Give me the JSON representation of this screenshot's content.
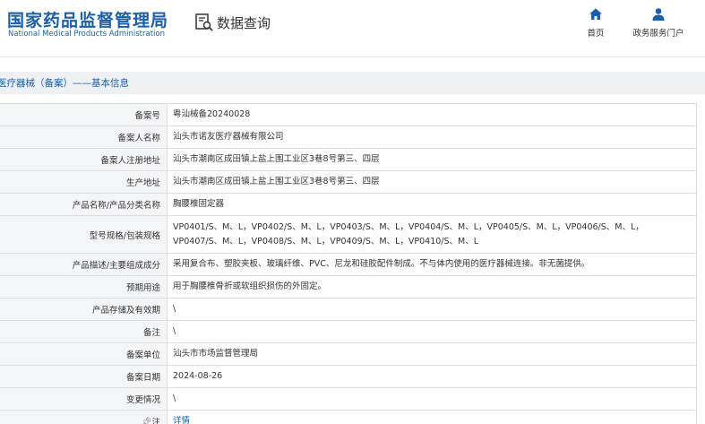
{
  "header": {
    "logo_cn": "国家药品监督管理局",
    "logo_en": "National Medical Products Administration",
    "query_label": "数据查询",
    "nav": [
      {
        "label": "首页",
        "icon": "home-icon"
      },
      {
        "label": "政务服务门户",
        "icon": "user-icon"
      }
    ]
  },
  "colors": {
    "brand": "#1a5fa8",
    "label_bg": "#f4f5f7",
    "border": "#dcdfe3",
    "section_bg": "#eef0f3"
  },
  "section_title": "医疗器械（备案）——基本信息",
  "rows": [
    {
      "label": "备案号",
      "value": "粤汕械备20240028"
    },
    {
      "label": "备案人名称",
      "value": "汕头市诺友医疗器械有限公司"
    },
    {
      "label": "备案人注册地址",
      "value": "汕头市潮南区成田镇上盐上围工业区3巷8号第三、四层"
    },
    {
      "label": "生产地址",
      "value": "汕头市潮南区成田镇上盐上围工业区3巷8号第三、四层"
    },
    {
      "label": "产品名称/产品分类名称",
      "value": "胸腰椎固定器"
    },
    {
      "label": "型号规格/包装规格",
      "value": "VP0401/S、M、L，VP0402/S、M、L，VP0403/S、M、L，VP0404/S、M、L，VP0405/S、M、L，VP0406/S、M、L，VP0407/S、M、L，VP0408/S、M、L，VP0409/S、M、L，VP0410/S、M、L"
    },
    {
      "label": "产品描述/主要组成成分",
      "value": "采用复合布、塑胶夹板、玻璃纤维、PVC、尼龙和硅胶配件制成。不与体内使用的医疗器械连接。非无菌提供。"
    },
    {
      "label": "预期用途",
      "value": "用于胸腰椎骨折或软组织损伤的外固定。"
    },
    {
      "label": "产品存储及有效期",
      "value": "\\"
    },
    {
      "label": "备注",
      "value": "\\"
    },
    {
      "label": "备案单位",
      "value": "汕头市市场监督管理局"
    },
    {
      "label": "备案日期",
      "value": "2024-08-26"
    },
    {
      "label": "变更情况",
      "value": "\\"
    },
    {
      "label": "注",
      "value": "详情",
      "pin_icon": "pin-icon"
    }
  ]
}
